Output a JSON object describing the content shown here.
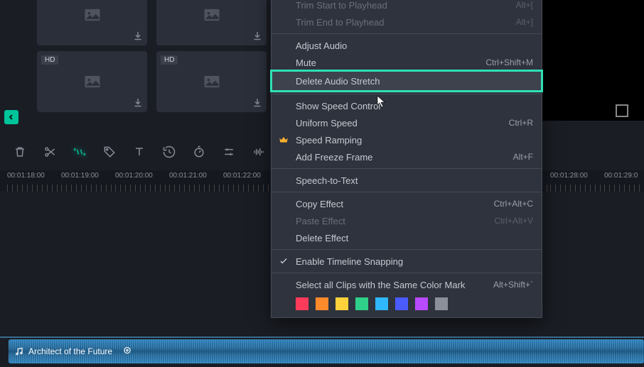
{
  "media": {
    "thumbs": [
      {
        "hd": false
      },
      {
        "hd": false
      },
      {
        "hd": true
      },
      {
        "hd": true
      }
    ],
    "hd_label": "HD"
  },
  "toolbar": {
    "tools": [
      "delete",
      "scissors",
      "audio-stretch",
      "tag",
      "text",
      "clock-back",
      "stopwatch",
      "sliders",
      "waveform"
    ]
  },
  "ruler": {
    "times": [
      "00:01:18:00",
      "00:01:19:00",
      "00:01:20:00",
      "00:01:21:00",
      "00:01:22:00",
      "00:01:28:00",
      "00:01:29:0"
    ]
  },
  "audio_clip": {
    "title": "Architect of the Future"
  },
  "context_menu": [
    {
      "type": "item",
      "label": "Trim Start to Playhead",
      "shortcut": "Alt+[",
      "disabled": true
    },
    {
      "type": "item",
      "label": "Trim End to Playhead",
      "shortcut": "Alt+]",
      "disabled": true
    },
    {
      "type": "sep"
    },
    {
      "type": "item",
      "label": "Adjust Audio"
    },
    {
      "type": "item",
      "label": "Mute",
      "shortcut": "Ctrl+Shift+M"
    },
    {
      "type": "item",
      "label": "Delete Audio Stretch",
      "highlighted": true
    },
    {
      "type": "sep"
    },
    {
      "type": "item",
      "label": "Show Speed Control"
    },
    {
      "type": "item",
      "label": "Uniform Speed",
      "shortcut": "Ctrl+R"
    },
    {
      "type": "item",
      "label": "Speed Ramping",
      "icon": "crown"
    },
    {
      "type": "item",
      "label": "Add Freeze Frame",
      "shortcut": "Alt+F"
    },
    {
      "type": "sep"
    },
    {
      "type": "item",
      "label": "Speech-to-Text"
    },
    {
      "type": "sep"
    },
    {
      "type": "item",
      "label": "Copy Effect",
      "shortcut": "Ctrl+Alt+C"
    },
    {
      "type": "item",
      "label": "Paste Effect",
      "shortcut": "Ctrl+Alt+V",
      "disabled": true
    },
    {
      "type": "item",
      "label": "Delete Effect"
    },
    {
      "type": "sep"
    },
    {
      "type": "item",
      "label": "Enable Timeline Snapping",
      "icon": "check"
    },
    {
      "type": "sep"
    },
    {
      "type": "item",
      "label": "Select all Clips with the Same Color Mark",
      "shortcut": "Alt+Shift+`"
    },
    {
      "type": "colors",
      "colors": [
        "#ff3b5c",
        "#ff8a2b",
        "#ffd23b",
        "#2fd08a",
        "#2fb8ff",
        "#4a5bff",
        "#b84aff",
        "#8a8f99"
      ]
    }
  ]
}
